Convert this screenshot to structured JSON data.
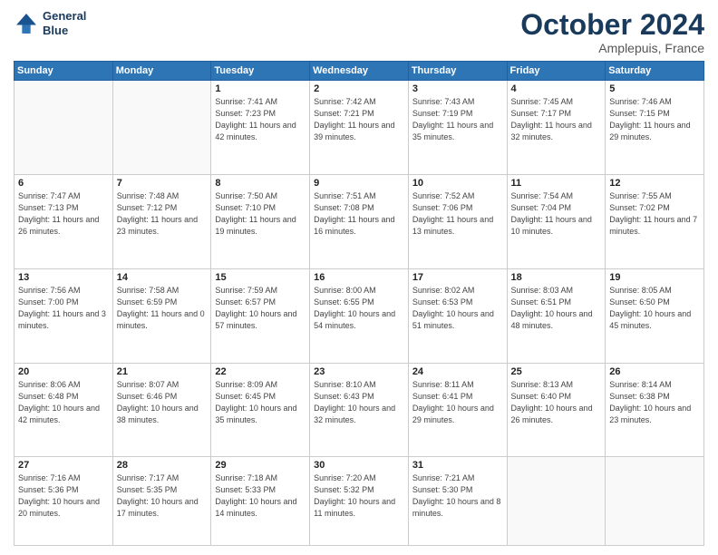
{
  "header": {
    "logo_line1": "General",
    "logo_line2": "Blue",
    "month": "October 2024",
    "location": "Amplepuis, France"
  },
  "weekdays": [
    "Sunday",
    "Monday",
    "Tuesday",
    "Wednesday",
    "Thursday",
    "Friday",
    "Saturday"
  ],
  "weeks": [
    [
      {
        "day": "",
        "info": ""
      },
      {
        "day": "",
        "info": ""
      },
      {
        "day": "1",
        "info": "Sunrise: 7:41 AM\nSunset: 7:23 PM\nDaylight: 11 hours and 42 minutes."
      },
      {
        "day": "2",
        "info": "Sunrise: 7:42 AM\nSunset: 7:21 PM\nDaylight: 11 hours and 39 minutes."
      },
      {
        "day": "3",
        "info": "Sunrise: 7:43 AM\nSunset: 7:19 PM\nDaylight: 11 hours and 35 minutes."
      },
      {
        "day": "4",
        "info": "Sunrise: 7:45 AM\nSunset: 7:17 PM\nDaylight: 11 hours and 32 minutes."
      },
      {
        "day": "5",
        "info": "Sunrise: 7:46 AM\nSunset: 7:15 PM\nDaylight: 11 hours and 29 minutes."
      }
    ],
    [
      {
        "day": "6",
        "info": "Sunrise: 7:47 AM\nSunset: 7:13 PM\nDaylight: 11 hours and 26 minutes."
      },
      {
        "day": "7",
        "info": "Sunrise: 7:48 AM\nSunset: 7:12 PM\nDaylight: 11 hours and 23 minutes."
      },
      {
        "day": "8",
        "info": "Sunrise: 7:50 AM\nSunset: 7:10 PM\nDaylight: 11 hours and 19 minutes."
      },
      {
        "day": "9",
        "info": "Sunrise: 7:51 AM\nSunset: 7:08 PM\nDaylight: 11 hours and 16 minutes."
      },
      {
        "day": "10",
        "info": "Sunrise: 7:52 AM\nSunset: 7:06 PM\nDaylight: 11 hours and 13 minutes."
      },
      {
        "day": "11",
        "info": "Sunrise: 7:54 AM\nSunset: 7:04 PM\nDaylight: 11 hours and 10 minutes."
      },
      {
        "day": "12",
        "info": "Sunrise: 7:55 AM\nSunset: 7:02 PM\nDaylight: 11 hours and 7 minutes."
      }
    ],
    [
      {
        "day": "13",
        "info": "Sunrise: 7:56 AM\nSunset: 7:00 PM\nDaylight: 11 hours and 3 minutes."
      },
      {
        "day": "14",
        "info": "Sunrise: 7:58 AM\nSunset: 6:59 PM\nDaylight: 11 hours and 0 minutes."
      },
      {
        "day": "15",
        "info": "Sunrise: 7:59 AM\nSunset: 6:57 PM\nDaylight: 10 hours and 57 minutes."
      },
      {
        "day": "16",
        "info": "Sunrise: 8:00 AM\nSunset: 6:55 PM\nDaylight: 10 hours and 54 minutes."
      },
      {
        "day": "17",
        "info": "Sunrise: 8:02 AM\nSunset: 6:53 PM\nDaylight: 10 hours and 51 minutes."
      },
      {
        "day": "18",
        "info": "Sunrise: 8:03 AM\nSunset: 6:51 PM\nDaylight: 10 hours and 48 minutes."
      },
      {
        "day": "19",
        "info": "Sunrise: 8:05 AM\nSunset: 6:50 PM\nDaylight: 10 hours and 45 minutes."
      }
    ],
    [
      {
        "day": "20",
        "info": "Sunrise: 8:06 AM\nSunset: 6:48 PM\nDaylight: 10 hours and 42 minutes."
      },
      {
        "day": "21",
        "info": "Sunrise: 8:07 AM\nSunset: 6:46 PM\nDaylight: 10 hours and 38 minutes."
      },
      {
        "day": "22",
        "info": "Sunrise: 8:09 AM\nSunset: 6:45 PM\nDaylight: 10 hours and 35 minutes."
      },
      {
        "day": "23",
        "info": "Sunrise: 8:10 AM\nSunset: 6:43 PM\nDaylight: 10 hours and 32 minutes."
      },
      {
        "day": "24",
        "info": "Sunrise: 8:11 AM\nSunset: 6:41 PM\nDaylight: 10 hours and 29 minutes."
      },
      {
        "day": "25",
        "info": "Sunrise: 8:13 AM\nSunset: 6:40 PM\nDaylight: 10 hours and 26 minutes."
      },
      {
        "day": "26",
        "info": "Sunrise: 8:14 AM\nSunset: 6:38 PM\nDaylight: 10 hours and 23 minutes."
      }
    ],
    [
      {
        "day": "27",
        "info": "Sunrise: 7:16 AM\nSunset: 5:36 PM\nDaylight: 10 hours and 20 minutes."
      },
      {
        "day": "28",
        "info": "Sunrise: 7:17 AM\nSunset: 5:35 PM\nDaylight: 10 hours and 17 minutes."
      },
      {
        "day": "29",
        "info": "Sunrise: 7:18 AM\nSunset: 5:33 PM\nDaylight: 10 hours and 14 minutes."
      },
      {
        "day": "30",
        "info": "Sunrise: 7:20 AM\nSunset: 5:32 PM\nDaylight: 10 hours and 11 minutes."
      },
      {
        "day": "31",
        "info": "Sunrise: 7:21 AM\nSunset: 5:30 PM\nDaylight: 10 hours and 8 minutes."
      },
      {
        "day": "",
        "info": ""
      },
      {
        "day": "",
        "info": ""
      }
    ]
  ]
}
